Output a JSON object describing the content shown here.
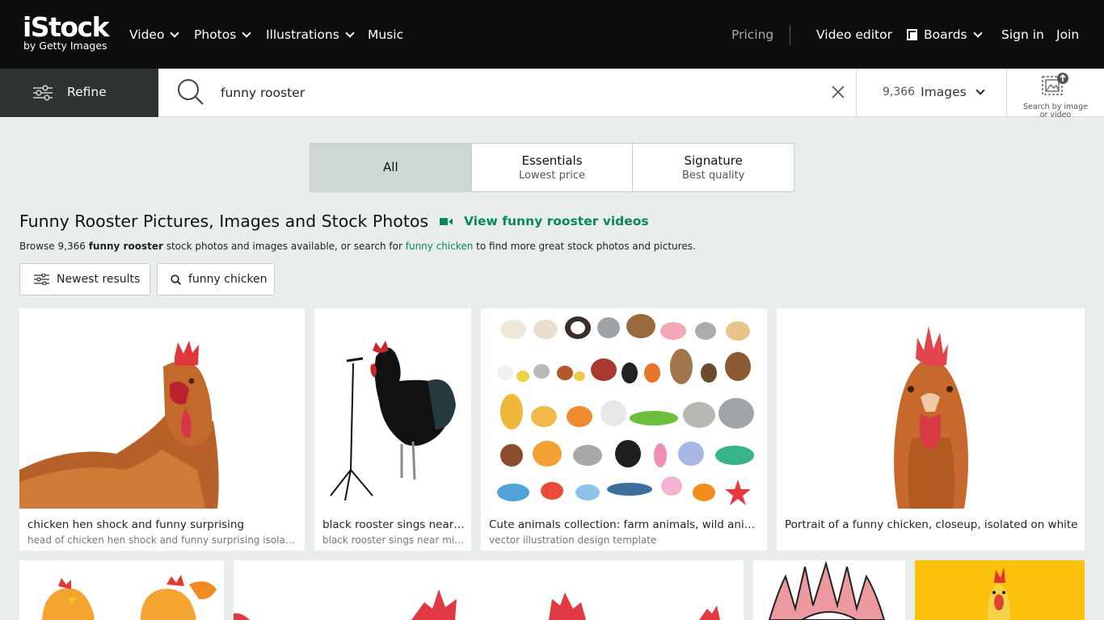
{
  "brand": {
    "name": "iStock",
    "sub": "by Getty Images"
  },
  "nav": {
    "video": "Video",
    "photos": "Photos",
    "illustrations": "Illustrations",
    "music": "Music",
    "pricing": "Pricing",
    "video_editor": "Video editor",
    "boards": "Boards",
    "sign_in": "Sign in",
    "join": "Join"
  },
  "search": {
    "refine_label": "Refine",
    "query": "funny rooster",
    "count": "9,366",
    "media_type": "Images",
    "search_by_image_line1": "Search by image",
    "search_by_image_line2": "or video"
  },
  "tabs": [
    {
      "title": "All",
      "sub": ""
    },
    {
      "title": "Essentials",
      "sub": "Lowest price"
    },
    {
      "title": "Signature",
      "sub": "Best quality"
    }
  ],
  "page": {
    "headline": "Funny Rooster Pictures, Images and Stock Photos",
    "video_link": "View funny rooster videos",
    "browse_pre": "Browse 9,366 ",
    "browse_term": "funny rooster",
    "browse_mid": " stock photos and images available, or search for ",
    "browse_link": "funny chicken",
    "browse_post": " to find more great stock photos and pictures."
  },
  "chips": {
    "sort": "Newest results",
    "related": "funny chicken"
  },
  "results": [
    {
      "title": "chicken hen shock and funny surprising",
      "sub": "head of chicken hen shock and funny surprising isolated on white background"
    },
    {
      "title": "black rooster sings near microphone",
      "sub": "black rooster sings near microphone isolated on white"
    },
    {
      "title": "Cute animals collection: farm animals, wild animals",
      "sub": "vector illustration design template"
    },
    {
      "title": "Portrait of a funny chicken, closeup, isolated on white",
      "sub": ""
    }
  ],
  "colors": {
    "nav_bg": "#0c0d0d",
    "accent_green": "#08875f",
    "page_bg": "#e9eeed",
    "refine_bg": "#2e3232"
  }
}
